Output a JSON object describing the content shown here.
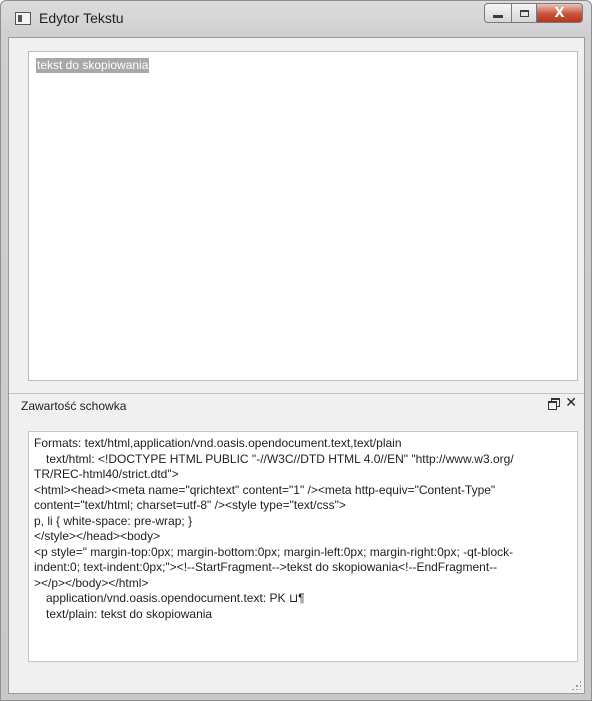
{
  "window": {
    "title": "Edytor Tekstu",
    "icon": "app-window-icon",
    "buttons": {
      "minimize": "minimize-icon",
      "maximize": "maximize-icon",
      "close_glyph": "X"
    }
  },
  "editor": {
    "content": "tekst do skopiowania"
  },
  "dock": {
    "title": "Zawartość schowka",
    "float_icon": "float-window-icon",
    "close_glyph": "✕"
  },
  "clipboard": {
    "lines": [
      "Formats: text/html,application/vnd.oasis.opendocument.text,text/plain",
      "text/html: <!DOCTYPE HTML PUBLIC \"-//W3C//DTD HTML 4.0//EN\" \"http://www.w3.org/",
      "TR/REC-html40/strict.dtd\">",
      "<html><head><meta name=\"qrichtext\" content=\"1\" /><meta http-equiv=\"Content-Type\"",
      "content=\"text/html; charset=utf-8\" /><style type=\"text/css\">",
      "p, li { white-space: pre-wrap; }",
      "</style></head><body>",
      "<p style=\" margin-top:0px; margin-bottom:0px; margin-left:0px; margin-right:0px; -qt-block-",
      "indent:0; text-indent:0px;\"><!--StartFragment-->tekst do skopiowania<!--EndFragment--",
      "></p></body></html>",
      "application/vnd.oasis.opendocument.text: PK ⊔¶",
      "text/plain: tekst do skopiowania"
    ]
  }
}
